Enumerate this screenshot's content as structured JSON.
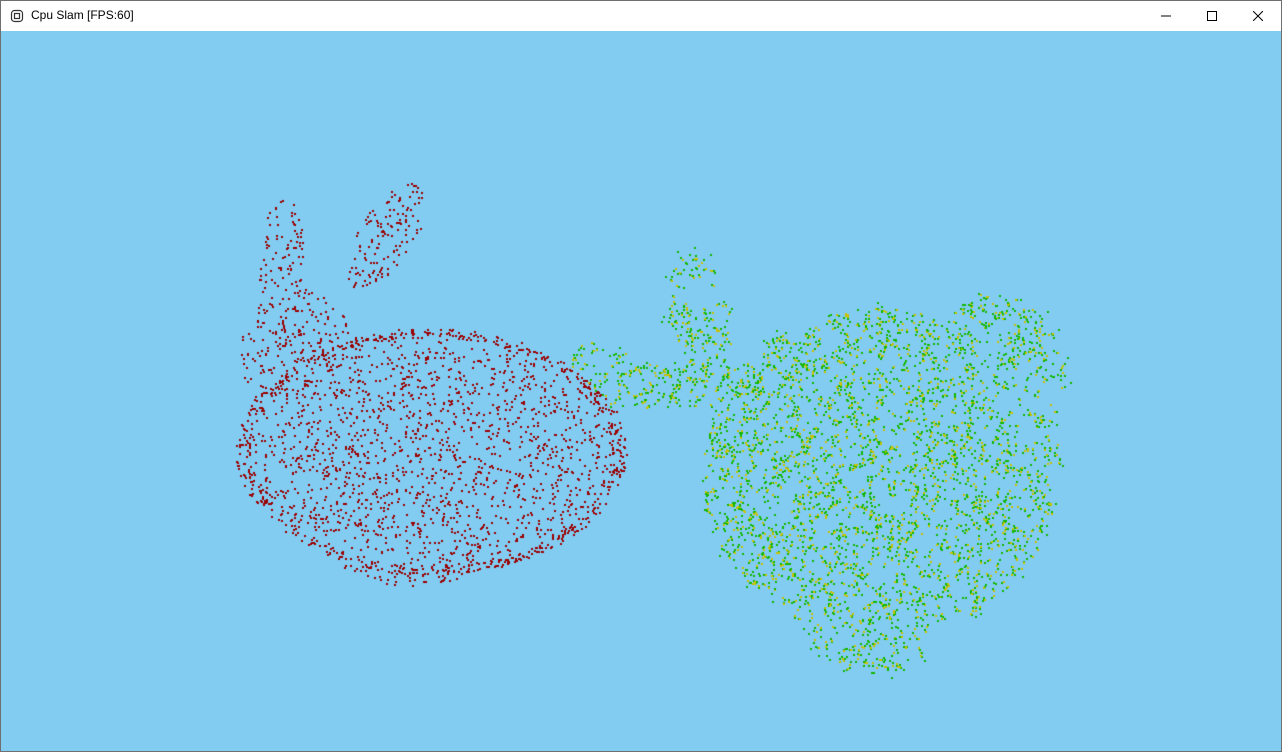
{
  "window": {
    "title": "Cpu Slam [FPS:60]",
    "icon": "app-icon",
    "controls": {
      "minimize_icon": "minimize-icon",
      "maximize_icon": "maximize-icon",
      "close_icon": "close-icon"
    }
  },
  "viewport": {
    "background_color": "#82cbf1",
    "point_clouds": [
      {
        "name_icon": "source-point-cloud",
        "color": "#9b0000",
        "style": "sparse-points"
      },
      {
        "name_icon": "target-point-cloud",
        "color": "#12b800",
        "secondary_color": "#c9c200",
        "style": "dense-points"
      }
    ]
  }
}
